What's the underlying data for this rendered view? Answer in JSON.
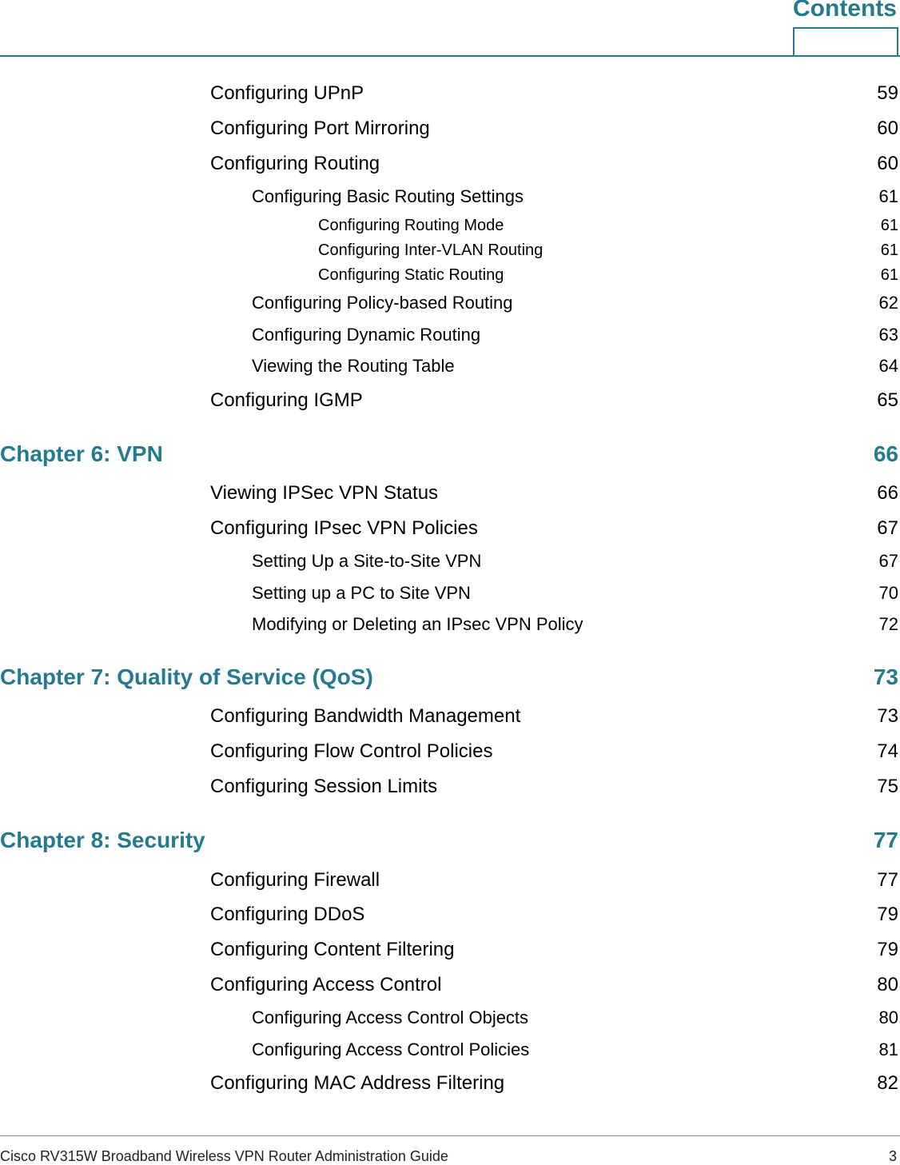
{
  "header": {
    "title": "Contents"
  },
  "entries": [
    {
      "level": "l1",
      "title": "Configuring UPnP",
      "page": "59"
    },
    {
      "level": "l1",
      "title": "Configuring Port Mirroring",
      "page": "60"
    },
    {
      "level": "l1",
      "title": "Configuring Routing",
      "page": "60"
    },
    {
      "level": "l2",
      "title": "Configuring Basic Routing Settings",
      "page": "61"
    },
    {
      "level": "l3",
      "title": "Configuring Routing Mode",
      "page": "61"
    },
    {
      "level": "l3",
      "title": "Configuring Inter-VLAN Routing",
      "page": "61"
    },
    {
      "level": "l3",
      "title": "Configuring Static Routing",
      "page": "61"
    },
    {
      "level": "l2",
      "title": "Configuring Policy-based Routing",
      "page": "62"
    },
    {
      "level": "l2",
      "title": "Configuring Dynamic Routing",
      "page": "63"
    },
    {
      "level": "l2",
      "title": "Viewing the Routing Table",
      "page": "64"
    },
    {
      "level": "l1",
      "title": "Configuring IGMP",
      "page": "65"
    },
    {
      "level": "ch",
      "title": "Chapter 6: VPN",
      "page": "66"
    },
    {
      "level": "l1",
      "title": "Viewing IPSec VPN Status",
      "page": "66"
    },
    {
      "level": "l1",
      "title": "Configuring IPsec VPN Policies",
      "page": "67"
    },
    {
      "level": "l2",
      "title": "Setting Up a Site-to-Site VPN",
      "page": "67"
    },
    {
      "level": "l2",
      "title": "Setting up a PC to Site VPN",
      "page": "70"
    },
    {
      "level": "l2",
      "title": "Modifying or Deleting an IPsec VPN Policy",
      "page": "72"
    },
    {
      "level": "ch",
      "title": "Chapter 7: Quality of Service (QoS)",
      "page": "73"
    },
    {
      "level": "l1",
      "title": "Configuring Bandwidth Management",
      "page": "73"
    },
    {
      "level": "l1",
      "title": "Configuring Flow Control Policies",
      "page": "74"
    },
    {
      "level": "l1",
      "title": "Configuring Session Limits",
      "page": "75"
    },
    {
      "level": "ch",
      "title": "Chapter 8: Security",
      "page": "77"
    },
    {
      "level": "l1",
      "title": "Configuring Firewall",
      "page": "77"
    },
    {
      "level": "l1",
      "title": "Configuring DDoS",
      "page": "79"
    },
    {
      "level": "l1",
      "title": "Configuring Content Filtering",
      "page": "79"
    },
    {
      "level": "l1",
      "title": "Configuring Access Control",
      "page": "80"
    },
    {
      "level": "l2",
      "title": "Configuring Access Control Objects",
      "page": "80"
    },
    {
      "level": "l2",
      "title": "Configuring Access Control Policies",
      "page": "81"
    },
    {
      "level": "l1",
      "title": "Configuring MAC Address Filtering",
      "page": "82"
    }
  ],
  "footer": {
    "text": "Cisco RV315W Broadband Wireless VPN Router Administration Guide",
    "page": "3"
  }
}
